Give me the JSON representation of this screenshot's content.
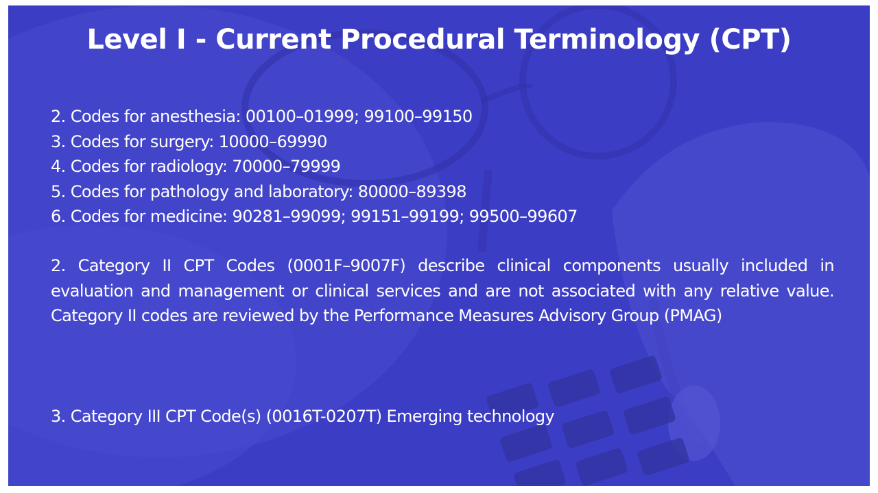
{
  "slide": {
    "title": "Level I - Current Procedural Terminology (CPT)",
    "code_ranges": [
      "2. Codes for anesthesia: 00100–01999; 99100–99150",
      "3. Codes for surgery: 10000–69990",
      "4. Codes for radiology: 70000–79999",
      "5. Codes for pathology and laboratory: 80000–89398",
      "6. Codes for medicine: 90281–99099; 99151–99199; 99500–99607"
    ],
    "category_ii": "2. Category II CPT Codes (0001F–9007F) describe clinical components usually included in evaluation and management or clinical services and are not associated with any relative value. Category II codes are reviewed by the Performance Measures Advisory Group (PMAG)",
    "category_iii": "3. Category III CPT Code(s) (0016T-0207T) Emerging technology",
    "theme": {
      "overlay_color": "#3d3ec6",
      "text_color": "#ffffff"
    }
  }
}
